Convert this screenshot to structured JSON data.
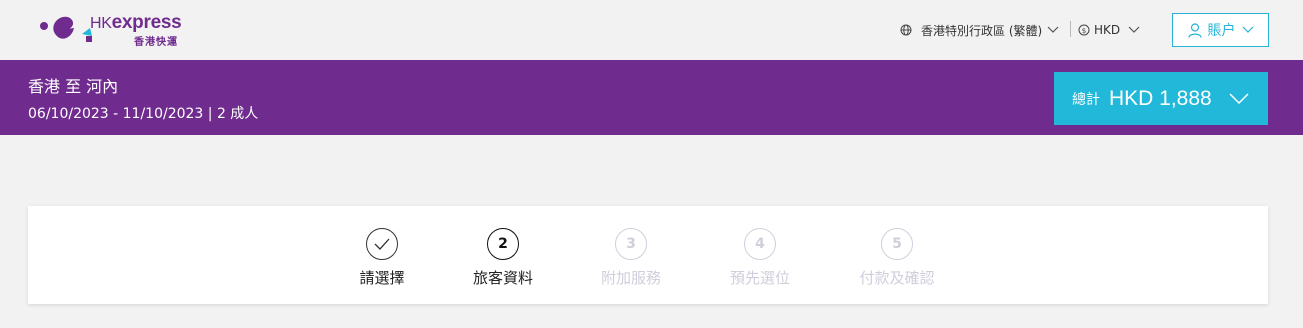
{
  "header": {
    "logo": {
      "brand": "HKexpress",
      "brand_prefix": "HK",
      "brand_suffix": "express",
      "subtitle": "香港快運"
    },
    "region": {
      "label": "香港特別行政區 (繁體)",
      "icon": "globe-icon"
    },
    "currency": {
      "label": "HKD",
      "icon": "coin-icon"
    },
    "account": {
      "label": "賬户",
      "icon": "user-icon"
    }
  },
  "trip": {
    "route": "香港 至 河內",
    "dates_pax": "06/10/2023 - 11/10/2023 | 2 成人",
    "total_label": "總計",
    "total_amount": "HKD 1,888"
  },
  "steps": [
    {
      "marker": "",
      "label": "請選擇",
      "state": "done"
    },
    {
      "marker": "2",
      "label": "旅客資料",
      "state": "current"
    },
    {
      "marker": "3",
      "label": "附加服務",
      "state": "todo"
    },
    {
      "marker": "4",
      "label": "預先選位",
      "state": "todo"
    },
    {
      "marker": "5",
      "label": "付款及確認",
      "state": "todo"
    }
  ],
  "colors": {
    "brand_purple": "#702b8f",
    "accent_cyan": "#22b8d9",
    "inactive_step": "#cfcfdc"
  }
}
